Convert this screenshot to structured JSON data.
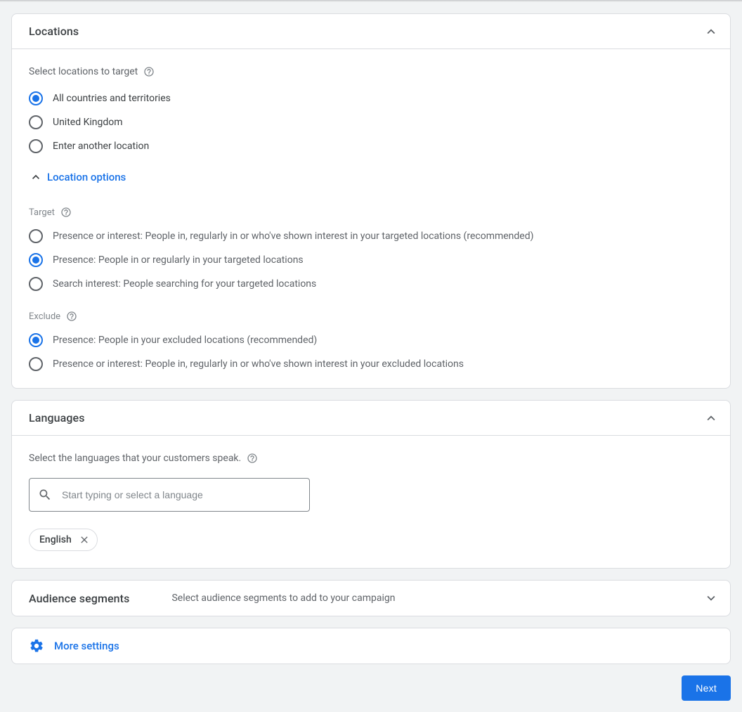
{
  "locations": {
    "title": "Locations",
    "select_label": "Select locations to target",
    "radios": {
      "all": "All countries and territories",
      "uk": "United Kingdom",
      "other": "Enter another location"
    },
    "options_toggle": "Location options",
    "target_label": "Target",
    "target_radios": {
      "presence_or_interest": "Presence or interest: People in, regularly in or who've shown interest in your targeted locations (recommended)",
      "presence": "Presence: People in or regularly in your targeted locations",
      "search_interest": "Search interest: People searching for your targeted locations"
    },
    "exclude_label": "Exclude",
    "exclude_radios": {
      "presence": "Presence: People in your excluded locations (recommended)",
      "presence_or_interest": "Presence or interest: People in, regularly in or who've shown interest in your excluded locations"
    }
  },
  "languages": {
    "title": "Languages",
    "select_label": "Select the languages that your customers speak.",
    "placeholder": "Start typing or select a language",
    "chips": {
      "english": "English"
    }
  },
  "audience": {
    "title": "Audience segments",
    "subtitle": "Select audience segments to add to your campaign"
  },
  "more_settings": "More settings",
  "next_button": "Next"
}
